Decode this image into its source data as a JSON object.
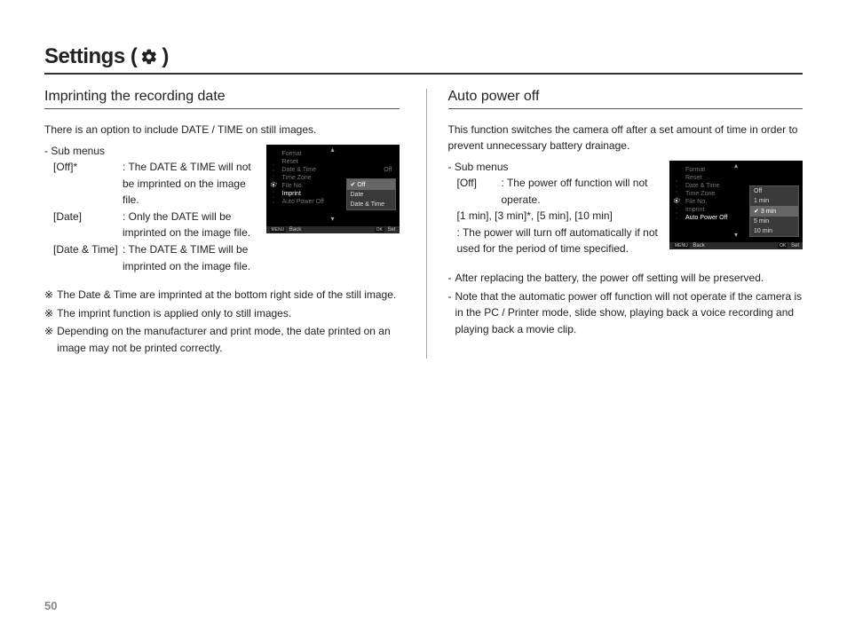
{
  "page_number": "50",
  "title_prefix": "Settings (",
  "title_suffix": ")",
  "left": {
    "heading": "Imprinting the recording date",
    "intro": "There is an option to include DATE / TIME on still images.",
    "sub_label": "- Sub menus",
    "defs": [
      {
        "key": "[Off]*",
        "val": ": The DATE & TIME will not be imprinted on the image file."
      },
      {
        "key": "[Date]",
        "val": ": Only the DATE will be imprinted on the image file."
      },
      {
        "key": "[Date & Time]",
        "val": ": The DATE & TIME will be imprinted on the image file."
      }
    ],
    "notes_mark": "※",
    "notes": [
      "The Date & Time are imprinted at the bottom right side of the still image.",
      "The imprint function is applied only to still images.",
      "Depending on the manufacturer and print mode, the date printed on an image may not be printed correctly."
    ],
    "screen": {
      "menu": [
        "Format",
        "Reset",
        "Date & Time",
        "Time Zone",
        "File No.",
        "Imprint",
        "Auto Power Off"
      ],
      "active_index": 5,
      "inline_value_index": 2,
      "inline_value": "Off",
      "options": [
        "Off",
        "Date",
        "Date & Time"
      ],
      "selected_option": 0,
      "footer_left_btn": "MENU",
      "footer_left": "Back",
      "footer_right_btn": "OK",
      "footer_right": "Set"
    }
  },
  "right": {
    "heading": "Auto power off",
    "intro": "This function switches the camera off after a set amount of time in order to prevent unnecessary battery drainage.",
    "sub_label": "- Sub menus",
    "defs": [
      {
        "key": "[Off]",
        "val": ": The power off function will not operate."
      },
      {
        "key": "[1 min], [3 min]*, [5 min], [10 min]\n: The power will turn off automatically if not used for the period of time specified."
      }
    ],
    "notes_mark": "-",
    "notes": [
      "After replacing the battery, the power off setting will be preserved.",
      "Note that the automatic power off function will not operate if the camera is in the PC / Printer mode, slide show, playing back a voice recording and playing back a movie clip."
    ],
    "screen": {
      "menu": [
        "Format",
        "Reset",
        "Date & Time",
        "Time Zone",
        "File No.",
        "Imprint",
        "Auto Power Off"
      ],
      "active_index": 6,
      "options": [
        "Off",
        "1 min",
        "3 min",
        "5 min",
        "10 min"
      ],
      "selected_option": 2,
      "footer_left_btn": "MENU",
      "footer_left": "Back",
      "footer_right_btn": "OK",
      "footer_right": "Set"
    }
  }
}
